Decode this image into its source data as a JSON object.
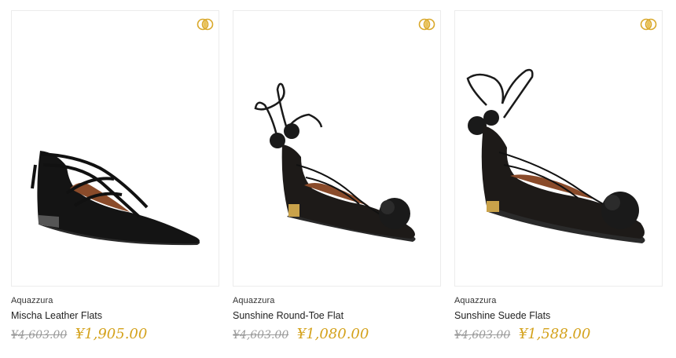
{
  "products": [
    {
      "brand": "Aquazzura",
      "name": "Mischa Leather Flats",
      "original_price": "¥4,603.00",
      "sale_price": "¥1,905.00",
      "compare_icon": "compare-rings-icon"
    },
    {
      "brand": "Aquazzura",
      "name": "Sunshine Round-Toe Flat",
      "original_price": "¥4,603.00",
      "sale_price": "¥1,080.00",
      "compare_icon": "compare-rings-icon"
    },
    {
      "brand": "Aquazzura",
      "name": "Sunshine Suede Flats",
      "original_price": "¥4,603.00",
      "sale_price": "¥1,588.00",
      "compare_icon": "compare-rings-icon"
    }
  ],
  "colors": {
    "sale_price": "#d4a21c",
    "original_price": "#9a9a9a",
    "icon_gold": "#d9a82a"
  }
}
